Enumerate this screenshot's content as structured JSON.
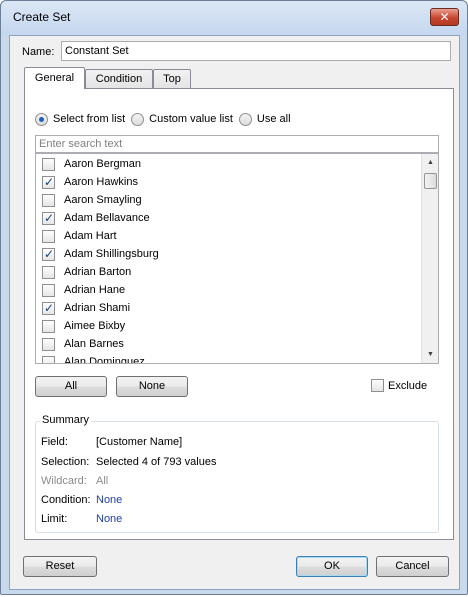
{
  "window": {
    "title": "Create Set",
    "close_glyph": "✕"
  },
  "name": {
    "label": "Name:",
    "value": "Constant Set"
  },
  "tabs": [
    {
      "label": "General",
      "active": true
    },
    {
      "label": "Condition",
      "active": false
    },
    {
      "label": "Top",
      "active": false
    }
  ],
  "selection_mode": {
    "options": [
      {
        "label": "Select from list",
        "checked": true
      },
      {
        "label": "Custom value list",
        "checked": false
      },
      {
        "label": "Use all",
        "checked": false
      }
    ]
  },
  "search": {
    "placeholder": "Enter search text"
  },
  "list": {
    "items": [
      {
        "label": "Aaron Bergman",
        "checked": false
      },
      {
        "label": "Aaron Hawkins",
        "checked": true
      },
      {
        "label": "Aaron Smayling",
        "checked": false
      },
      {
        "label": "Adam Bellavance",
        "checked": true
      },
      {
        "label": "Adam Hart",
        "checked": false
      },
      {
        "label": "Adam Shillingsburg",
        "checked": true
      },
      {
        "label": "Adrian Barton",
        "checked": false
      },
      {
        "label": "Adrian Hane",
        "checked": false
      },
      {
        "label": "Adrian Shami",
        "checked": true
      },
      {
        "label": "Aimee Bixby",
        "checked": false
      },
      {
        "label": "Alan Barnes",
        "checked": false
      },
      {
        "label": "Alan Dominguez",
        "checked": false
      }
    ],
    "scroll_up": "▲",
    "scroll_down": "▼"
  },
  "list_buttons": {
    "all_label": "All",
    "none_label": "None"
  },
  "exclude": {
    "label": "Exclude",
    "checked": false
  },
  "summary": {
    "title": "Summary",
    "field_key": "Field:",
    "field_val": "[Customer Name]",
    "selection_key": "Selection:",
    "selection_val": "Selected 4 of 793 values",
    "wildcard_key": "Wildcard:",
    "wildcard_val": "All",
    "condition_key": "Condition:",
    "condition_val": "None",
    "limit_key": "Limit:",
    "limit_val": "None"
  },
  "footer": {
    "reset_label": "Reset",
    "ok_label": "OK",
    "cancel_label": "Cancel"
  },
  "colors": {
    "title_bar": "#c5d7ee",
    "link": "#1f3fa8",
    "close": "#c8472f"
  }
}
